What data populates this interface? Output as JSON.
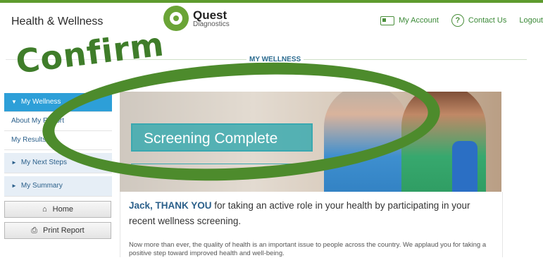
{
  "app": {
    "title": "Health & Wellness"
  },
  "logo": {
    "name": "Quest",
    "sub": "Diagnostics"
  },
  "topnav": {
    "account": "My Account",
    "contact": "Contact Us",
    "logout": "Logout"
  },
  "section": {
    "title": "MY WELLNESS"
  },
  "overlay": {
    "confirm": "Confirm"
  },
  "sidebar": {
    "wellness": "My Wellness",
    "about_report": "About My Report",
    "results": "My Results",
    "next_steps": "My Next Steps",
    "summary": "My Summary",
    "home": "Home",
    "print": "Print Report"
  },
  "hero": {
    "banner": "Screening Complete"
  },
  "main": {
    "name": "Jack, THANK YOU",
    "thanks": " for taking an active role in your health by participating in your recent wellness screening.",
    "description": "Now more than ever, the quality of health is an important issue to people across the country. We applaud you for taking a positive step toward improved health and well-being."
  },
  "colors": {
    "brand_green": "#5e9b2e",
    "accent_blue": "#2d9fd8",
    "banner_teal": "#3aa8b0",
    "annotation_green": "#4d8b2c"
  }
}
